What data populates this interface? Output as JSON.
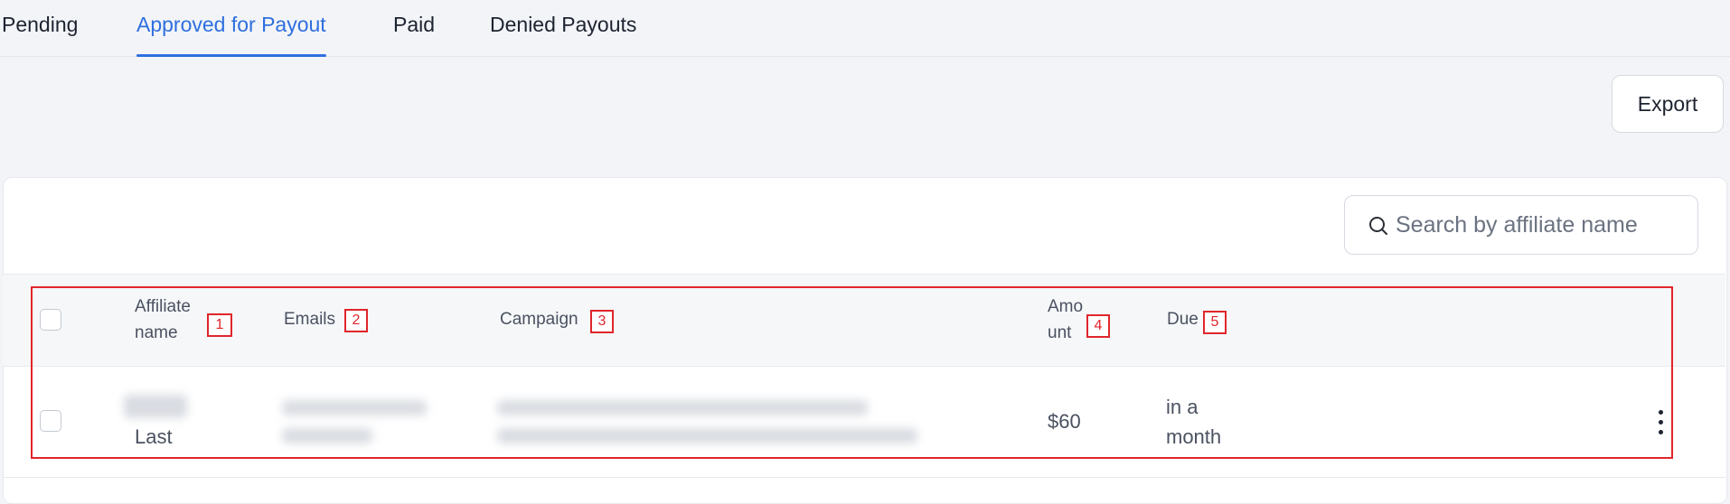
{
  "tabs": [
    {
      "label": "Pending"
    },
    {
      "label": "Approved for Payout",
      "active": true
    },
    {
      "label": "Paid"
    },
    {
      "label": "Denied Payouts"
    }
  ],
  "toolbar": {
    "export_label": "Export"
  },
  "search": {
    "placeholder": "Search by affiliate name",
    "value": ""
  },
  "table": {
    "columns": [
      {
        "line1": "Affiliate",
        "line2": "name",
        "marker": "1"
      },
      {
        "label": "Emails",
        "marker": "2"
      },
      {
        "label": "Campaign",
        "marker": "3"
      },
      {
        "line1": "Amo",
        "line2": "unt",
        "marker": "4"
      },
      {
        "label": "Due",
        "marker": "5"
      }
    ],
    "rows": [
      {
        "affiliate_last": "Last",
        "amount": "$60",
        "due_line1": "in a",
        "due_line2": "month"
      }
    ]
  },
  "icons": {
    "search": "search-icon",
    "row_menu": "more-vertical-icon"
  },
  "colors": {
    "accent": "#2f6fdf",
    "annotation": "#e0262b"
  }
}
